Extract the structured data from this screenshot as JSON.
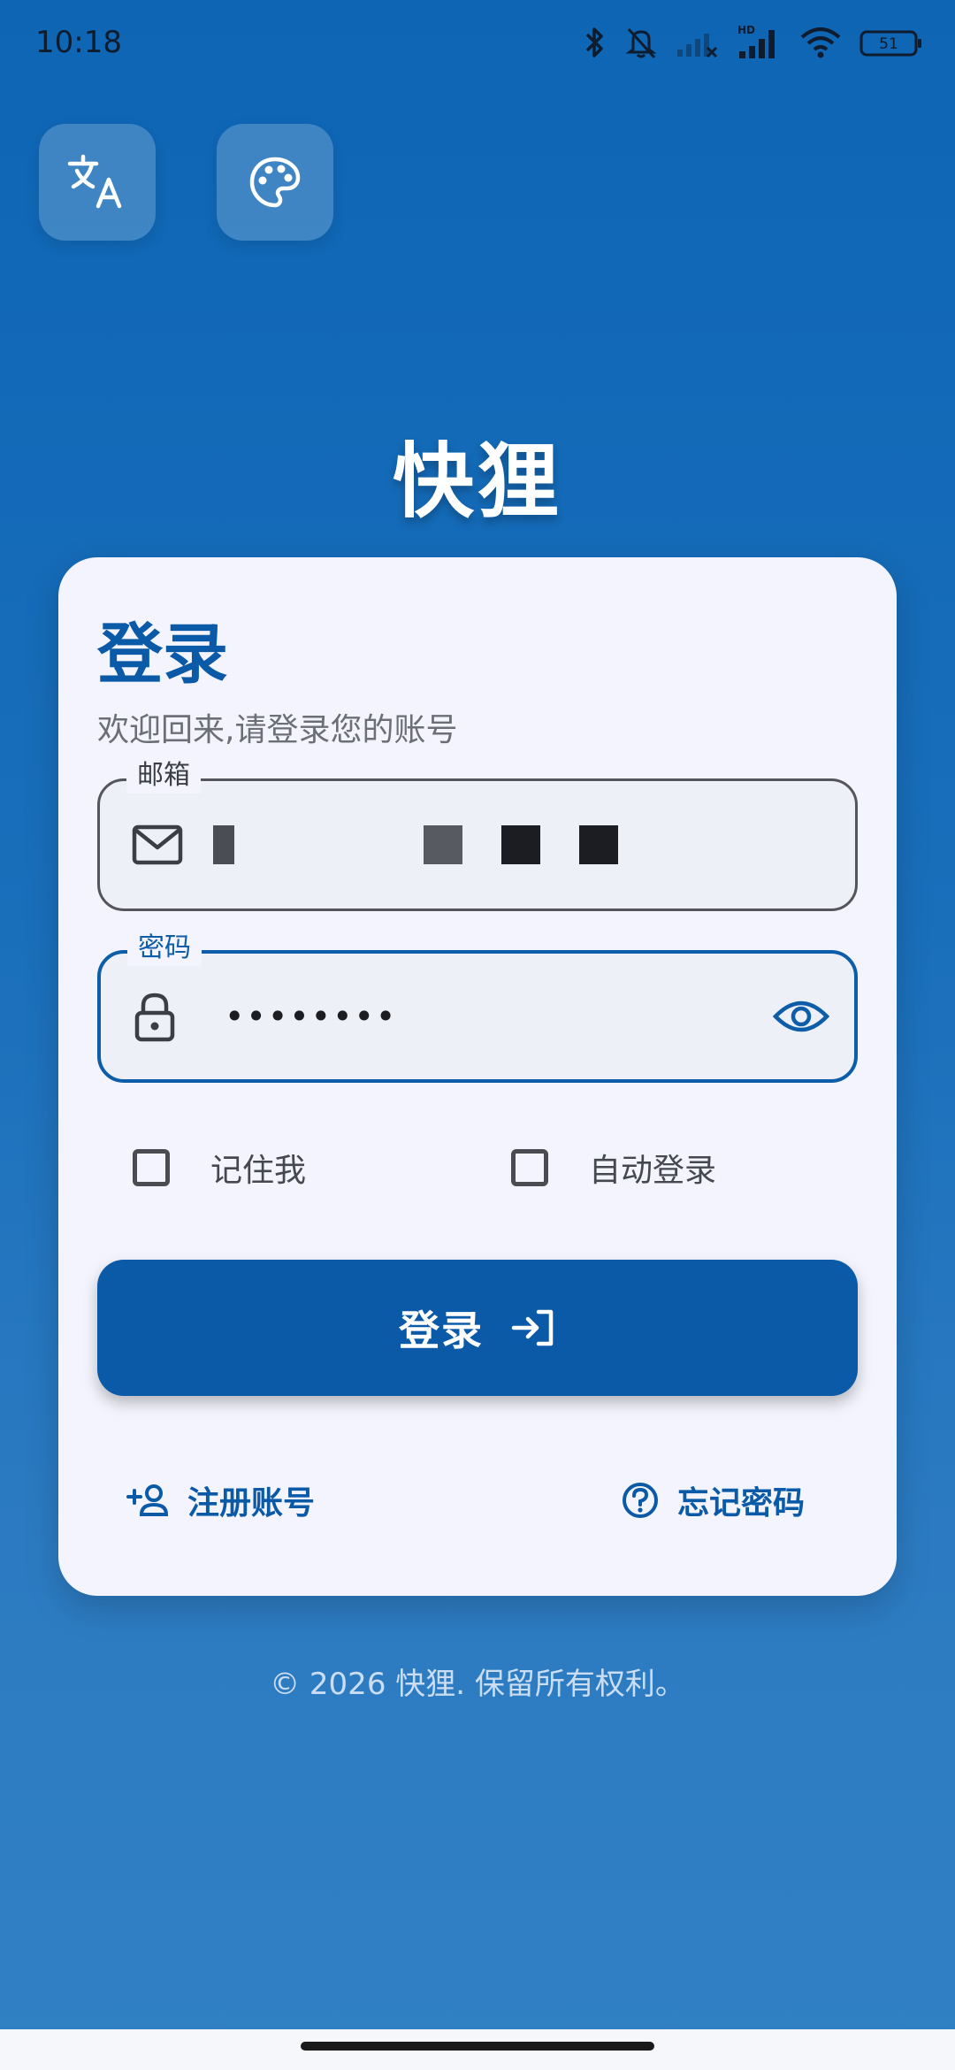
{
  "status_bar": {
    "time": "10:18",
    "battery": "51"
  },
  "top_buttons": {
    "translate_icon": "translate-icon",
    "palette_icon": "palette-icon"
  },
  "app": {
    "title": "快狸"
  },
  "card": {
    "title": "登录",
    "subtitle": "欢迎回来,请登录您的账号"
  },
  "email_field": {
    "label": "邮箱",
    "icon": "mail-icon"
  },
  "password_field": {
    "label": "密码",
    "value": "••••••••",
    "icon": "lock-icon"
  },
  "options": {
    "remember_me": "记住我",
    "auto_login": "自动登录"
  },
  "login_button": {
    "label": "登录"
  },
  "links": {
    "register": "注册账号",
    "forgot": "忘记密码"
  },
  "footer": {
    "copyright": "© 2026 快狸. 保留所有权利。"
  },
  "colors": {
    "primary": "#0a5aa8",
    "card_bg": "#f3f4fd",
    "background_top": "#0d65b4",
    "background_bottom": "#3180c4"
  }
}
